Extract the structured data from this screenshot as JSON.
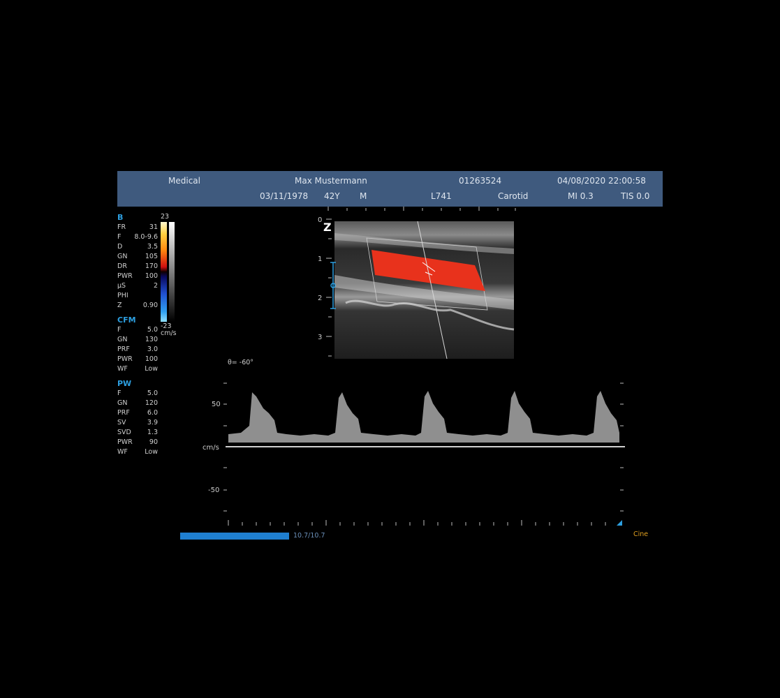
{
  "header": {
    "institution": "Medical",
    "patient_name": "Max Mustermann",
    "patient_id": "01263524",
    "datetime": "04/08/2020 22:00:58",
    "dob": "03/11/1978",
    "age": "42Y",
    "sex": "M",
    "probe": "L741",
    "preset": "Carotid",
    "mi": "MI 0.3",
    "tis": "TIS 0.0"
  },
  "params": {
    "b": {
      "title": "B",
      "rows": [
        {
          "k": "FR",
          "v": "31"
        },
        {
          "k": "F",
          "v": "8.0-9.6"
        },
        {
          "k": "D",
          "v": "3.5"
        },
        {
          "k": "GN",
          "v": "105"
        },
        {
          "k": "DR",
          "v": "170"
        },
        {
          "k": "PWR",
          "v": "100"
        },
        {
          "k": "µS",
          "v": "2"
        },
        {
          "k": "PHI",
          "v": ""
        },
        {
          "k": "Z",
          "v": "0.90"
        }
      ]
    },
    "cfm": {
      "title": "CFM",
      "rows": [
        {
          "k": "F",
          "v": "5.0"
        },
        {
          "k": "GN",
          "v": "130"
        },
        {
          "k": "PRF",
          "v": "3.0"
        },
        {
          "k": "PWR",
          "v": "100"
        },
        {
          "k": "WF",
          "v": "Low"
        }
      ]
    },
    "pw": {
      "title": "PW",
      "rows": [
        {
          "k": "F",
          "v": "5.0"
        },
        {
          "k": "GN",
          "v": "120"
        },
        {
          "k": "PRF",
          "v": "6.0"
        },
        {
          "k": "SV",
          "v": "3.9"
        },
        {
          "k": "SVD",
          "v": "1.3"
        },
        {
          "k": "PWR",
          "v": "90"
        },
        {
          "k": "WF",
          "v": "Low"
        }
      ]
    }
  },
  "colorbar": {
    "max": "23",
    "min": "-23",
    "unit": "cm/s"
  },
  "bmode": {
    "zoom_marker": "Z",
    "depth_labels": [
      "0",
      "1",
      "2",
      "3"
    ]
  },
  "doppler": {
    "angle": "θ= -60°",
    "unit": "cm/s",
    "velocity_labels": [
      "50",
      "-50"
    ]
  },
  "cine": {
    "progress_text": "10.7/10.7",
    "progress_fraction": 1.0,
    "label": "Cine"
  },
  "colors": {
    "header_bg": "#3f5a7e",
    "accent_blue": "#2d9fe0",
    "cine_orange": "#e0a020",
    "flow_red": "#e8321c"
  }
}
